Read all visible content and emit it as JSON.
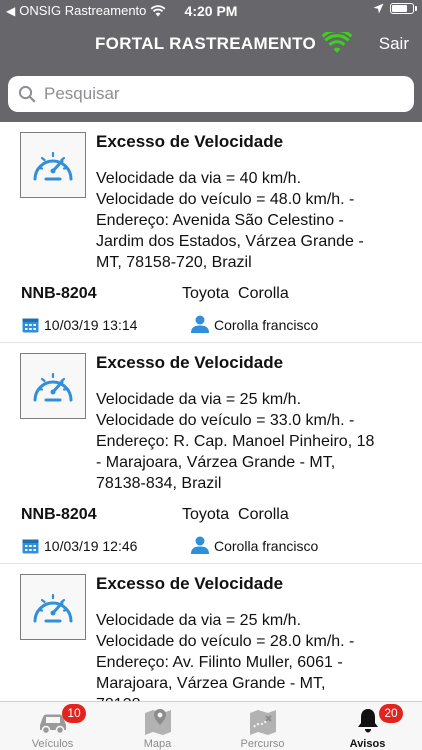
{
  "status_bar": {
    "carrier": "ONSIG Rastreamento",
    "time": "4:20 PM"
  },
  "nav": {
    "title": "FORTAL RASTREAMENTO",
    "logout_label": "Sair",
    "connection_color": "#3ecf1f"
  },
  "search": {
    "placeholder": "Pesquisar"
  },
  "alerts": [
    {
      "title": "Excesso de Velocidade",
      "line1": "Velocidade da via = 40 km/h.",
      "line2": "Velocidade do veículo = 48.0 km/h. -",
      "line3": "Endereço: Avenida São Celestino -",
      "line4": "Jardim dos Estados, Várzea Grande -",
      "line5": "MT, 78158-720, Brazil",
      "plate": "NNB-8204",
      "vehicle": "Toyota  Corolla",
      "datetime": "10/03/19 13:14",
      "driver": "Corolla francisco"
    },
    {
      "title": "Excesso de Velocidade",
      "line1": "Velocidade da via = 25 km/h.",
      "line2": "Velocidade do veículo = 33.0 km/h. -",
      "line3": "Endereço: R. Cap. Manoel Pinheiro, 18",
      "line4": "- Marajoara, Várzea Grande - MT,",
      "line5": "78138-834, Brazil",
      "plate": "NNB-8204",
      "vehicle": "Toyota  Corolla",
      "datetime": "10/03/19 12:46",
      "driver": "Corolla francisco"
    },
    {
      "title": "Excesso de Velocidade",
      "line1": "Velocidade da via = 25 km/h.",
      "line2": "Velocidade do veículo = 28.0 km/h. -",
      "line3": "Endereço: Av. Filinto Muller, 6061 -",
      "line4": "Marajoara, Várzea Grande - MT,",
      "line5": "78138-",
      "plate": "",
      "vehicle": "",
      "datetime": "",
      "driver": ""
    }
  ],
  "tabs": [
    {
      "label": "Veículos",
      "icon": "car-icon",
      "badge": "10"
    },
    {
      "label": "Mapa",
      "icon": "map-pin-icon",
      "badge": ""
    },
    {
      "label": "Percurso",
      "icon": "route-map-icon",
      "badge": ""
    },
    {
      "label": "Avisos",
      "icon": "bell-icon",
      "badge": "20",
      "active": true
    }
  ],
  "colors": {
    "bar": "#67666b",
    "accent_blue": "#2f8fd8",
    "badge": "#e3231d"
  }
}
